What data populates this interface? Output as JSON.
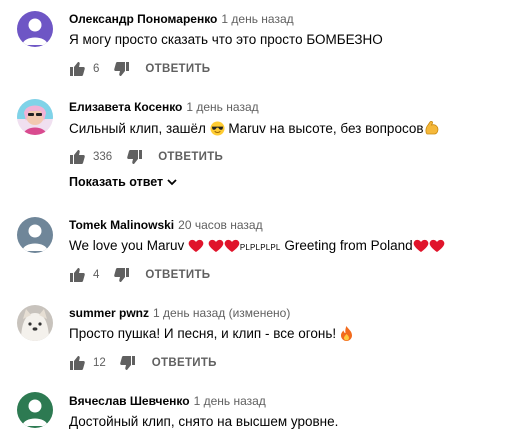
{
  "comments": [
    {
      "author": "Олександр Пономаренко",
      "time": "1 день назад",
      "text": "Я могу просто сказать что это просто БОМБЕЗНО",
      "likes": "6",
      "reply_label": "ОТВЕТИТЬ",
      "avatar_color": "#6e56c5"
    },
    {
      "author": "Елизавета Косенко",
      "time": "1 день назад",
      "text_a": "Сильный клип, зашёл ",
      "text_b": " Maruv на высоте, без вопросов",
      "likes": "336",
      "reply_label": "ОТВЕТИТЬ",
      "show_replies": "Показать ответ",
      "avatar_color": "#64c8e0"
    },
    {
      "author": "Tomek Malinowski",
      "time": "20 часов назад",
      "text_a": "We love you Maruv ",
      "text_small": "PLPLPLPL",
      "text_b": " Greeting from Poland",
      "likes": "4",
      "reply_label": "ОТВЕТИТЬ",
      "avatar_color": "#6f8699"
    },
    {
      "author": "summer pwnz",
      "time": "1 день назад (изменено)",
      "text": "Просто пушка! И песня, и клип - все огонь! ",
      "likes": "12",
      "reply_label": "ОТВЕТИТЬ",
      "avatar_color": "#c8c3bd"
    },
    {
      "author": "Вячеслав Шевченко",
      "time": "1 день назад",
      "text": "Достойный клип, снято на высшем уровне.",
      "avatar_color": "#2d7a52"
    }
  ],
  "icons": {
    "like": "thumbs-up-icon",
    "dislike": "thumbs-down-icon",
    "chevron": "chevron-down-icon",
    "heart_color": "#e0142b"
  }
}
